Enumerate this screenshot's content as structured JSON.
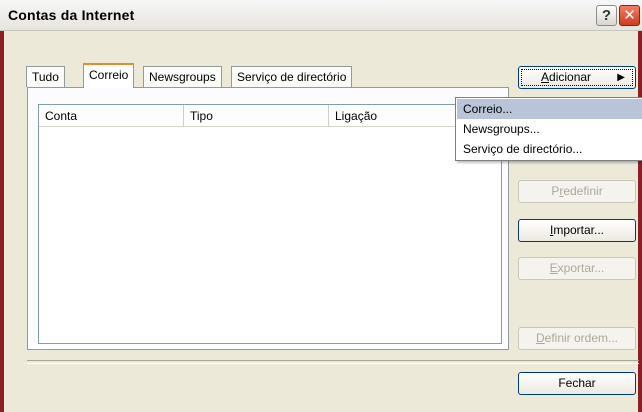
{
  "window": {
    "title": "Contas da Internet",
    "help_glyph": "?",
    "close_glyph": "✕"
  },
  "tabs": [
    {
      "label": "Tudo"
    },
    {
      "label": "Correio"
    },
    {
      "label": "Newsgroups"
    },
    {
      "label": "Serviço de directório"
    }
  ],
  "list": {
    "columns": [
      "Conta",
      "Tipo",
      "Ligação"
    ],
    "rows": []
  },
  "buttons": {
    "add": {
      "prefix": "",
      "accel": "A",
      "rest": "dicionar",
      "arrow": "▶"
    },
    "set_default": {
      "prefix": "P",
      "accel": "r",
      "rest": "edefinir"
    },
    "import": {
      "prefix": "",
      "accel": "I",
      "rest": "mportar..."
    },
    "export": {
      "prefix": "",
      "accel": "E",
      "rest": "xportar..."
    },
    "set_order": {
      "prefix": "",
      "accel": "D",
      "rest": "efinir ordem..."
    },
    "close": {
      "label": "Fechar"
    }
  },
  "add_menu": {
    "items": [
      "Correio...",
      "Newsgroups...",
      "Serviço de directório..."
    ],
    "highlighted_index": 0
  },
  "colors": {
    "window_frame": "#8a1f26",
    "dialog_bg": "#ece9d8",
    "menu_highlight": "#b9c4d8",
    "tab_accent": "#e68b2c"
  }
}
